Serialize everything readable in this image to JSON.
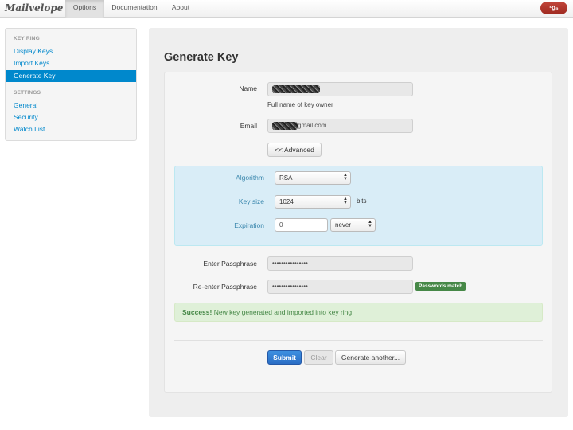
{
  "navbar": {
    "brand": "Mailvelope",
    "tabs": [
      {
        "label": "Options",
        "active": true
      },
      {
        "label": "Documentation",
        "active": false
      },
      {
        "label": "About",
        "active": false
      }
    ],
    "user_badge": "ᵋɡ₅"
  },
  "sidebar": {
    "keyring_header": "KEY RING",
    "keyring_items": [
      "Display Keys",
      "Import Keys",
      "Generate Key"
    ],
    "active_item": "Generate Key",
    "settings_header": "SETTINGS",
    "settings_items": [
      "General",
      "Security",
      "Watch List"
    ]
  },
  "form": {
    "title": "Generate Key",
    "name_label": "Name",
    "name_help": "Full name of key owner",
    "email_label": "Email",
    "email_suffix": "gmail.com",
    "advanced_button": "<< Advanced",
    "algorithm_label": "Algorithm",
    "algorithm_value": "RSA",
    "keysize_label": "Key size",
    "keysize_value": "1024",
    "keysize_unit": "bits",
    "expiration_label": "Expiration",
    "expiration_value": "0",
    "expiration_unit": "never",
    "passphrase_label": "Enter Passphrase",
    "passphrase_value": "••••••••••••••••",
    "repassphrase_label": "Re-enter Passphrase",
    "repassphrase_value": "••••••••••••••••",
    "passwords_match": "Passwords match",
    "success_strong": "Success!",
    "success_text": " New key generated and imported into key ring",
    "submit_label": "Submit",
    "clear_label": "Clear",
    "generate_another_label": "Generate another..."
  },
  "colors": {
    "accent": "#0088cc",
    "primary_button": "#2a6dc4",
    "success_bg": "#dff0d8",
    "advanced_bg": "#d9edf7",
    "badge_success": "#468847"
  }
}
